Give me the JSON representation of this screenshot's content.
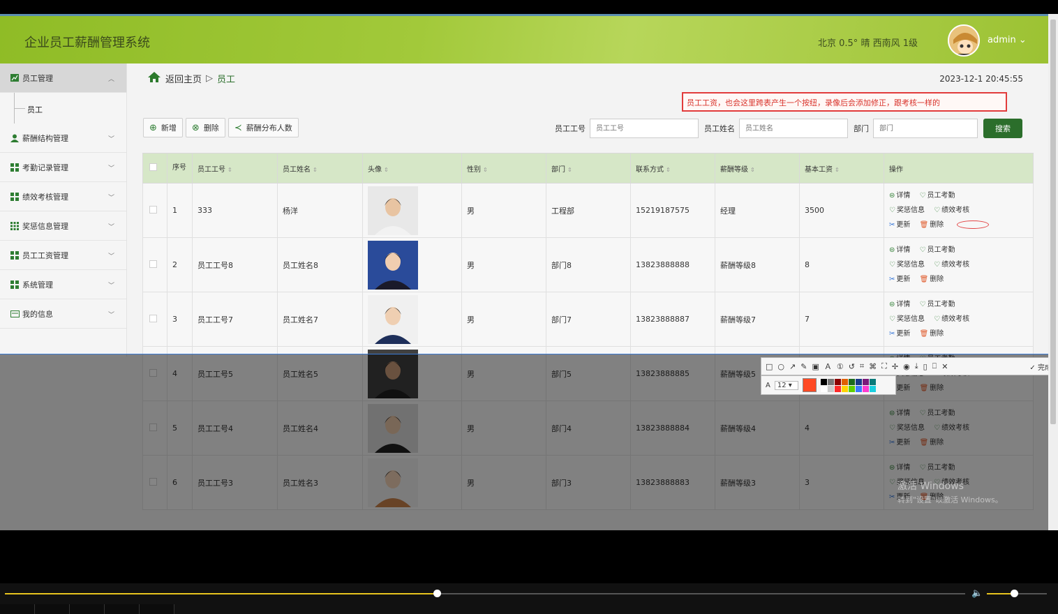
{
  "header": {
    "title": "企业员工薪酬管理系统",
    "weather": "北京 0.5° 晴 西南风 1级",
    "user": "admin ⌄"
  },
  "sidebar": {
    "items": [
      {
        "label": "员工管理",
        "icon": "chart-icon",
        "active": true
      },
      {
        "label": "薪酬结构管理",
        "icon": "person-icon"
      },
      {
        "label": "考勤记录管理",
        "icon": "grid-icon"
      },
      {
        "label": "绩效考核管理",
        "icon": "grid-icon"
      },
      {
        "label": "奖惩信息管理",
        "icon": "grid-icon"
      },
      {
        "label": "员工工资管理",
        "icon": "grid-icon"
      },
      {
        "label": "系统管理",
        "icon": "grid-icon"
      },
      {
        "label": "我的信息",
        "icon": "card-icon"
      }
    ],
    "sub_item": "员工"
  },
  "breadcrumb": {
    "home": "返回主页",
    "separator": "▷",
    "current": "员工"
  },
  "clock": "2023-12-1 20:45:55",
  "annotation_note": "员工工资，也会这里跨表产生一个按纽，录像后会添加修正，跟考核一样的",
  "toolbar": {
    "add": "新增",
    "delete": "删除",
    "salary_dist": "薪酬分布人数"
  },
  "search": {
    "emp_no_label": "员工工号",
    "emp_no_placeholder": "员工工号",
    "emp_name_label": "员工姓名",
    "emp_name_placeholder": "员工姓名",
    "dept_label": "部门",
    "dept_placeholder": "部门",
    "button": "搜索"
  },
  "table": {
    "headers": [
      "序号",
      "员工工号",
      "员工姓名",
      "头像",
      "性别",
      "部门",
      "联系方式",
      "薪酬等级",
      "基本工资",
      "操作"
    ],
    "ops": {
      "detail": "详情",
      "attendance": "员工考勤",
      "reward": "奖惩信息",
      "perf": "绩效考核",
      "update": "更新",
      "remove": "删除"
    },
    "rows": [
      {
        "idx": "1",
        "no": "333",
        "name": "杨洋",
        "gender": "男",
        "dept": "工程部",
        "phone": "15219187575",
        "grade": "经理",
        "salary": "3500"
      },
      {
        "idx": "2",
        "no": "员工工号8",
        "name": "员工姓名8",
        "gender": "男",
        "dept": "部门8",
        "phone": "13823888888",
        "grade": "薪酬等级8",
        "salary": "8"
      },
      {
        "idx": "3",
        "no": "员工工号7",
        "name": "员工姓名7",
        "gender": "男",
        "dept": "部门7",
        "phone": "13823888887",
        "grade": "薪酬等级7",
        "salary": "7"
      },
      {
        "idx": "4",
        "no": "员工工号5",
        "name": "员工姓名5",
        "gender": "男",
        "dept": "部门5",
        "phone": "13823888885",
        "grade": "薪酬等级5",
        "salary": ""
      },
      {
        "idx": "5",
        "no": "员工工号4",
        "name": "员工姓名4",
        "gender": "男",
        "dept": "部门4",
        "phone": "13823888884",
        "grade": "薪酬等级4",
        "salary": "4"
      },
      {
        "idx": "6",
        "no": "员工工号3",
        "name": "员工姓名3",
        "gender": "男",
        "dept": "部门3",
        "phone": "13823888883",
        "grade": "薪酬等级3",
        "salary": "3"
      }
    ]
  },
  "watermark": {
    "line1": "激活 Windows",
    "line2": "转到\"设置\"以激活 Windows。"
  },
  "snap_toolbar": {
    "done": "完成",
    "font_size": "12"
  },
  "player": {
    "progress_fraction": 0.45,
    "volume_fraction": 0.45
  },
  "colors": {
    "header_green": "#9cc233",
    "accent_green": "#2b6e2b",
    "table_header": "#d6e7c7",
    "annotation_red": "#e23b3b"
  }
}
